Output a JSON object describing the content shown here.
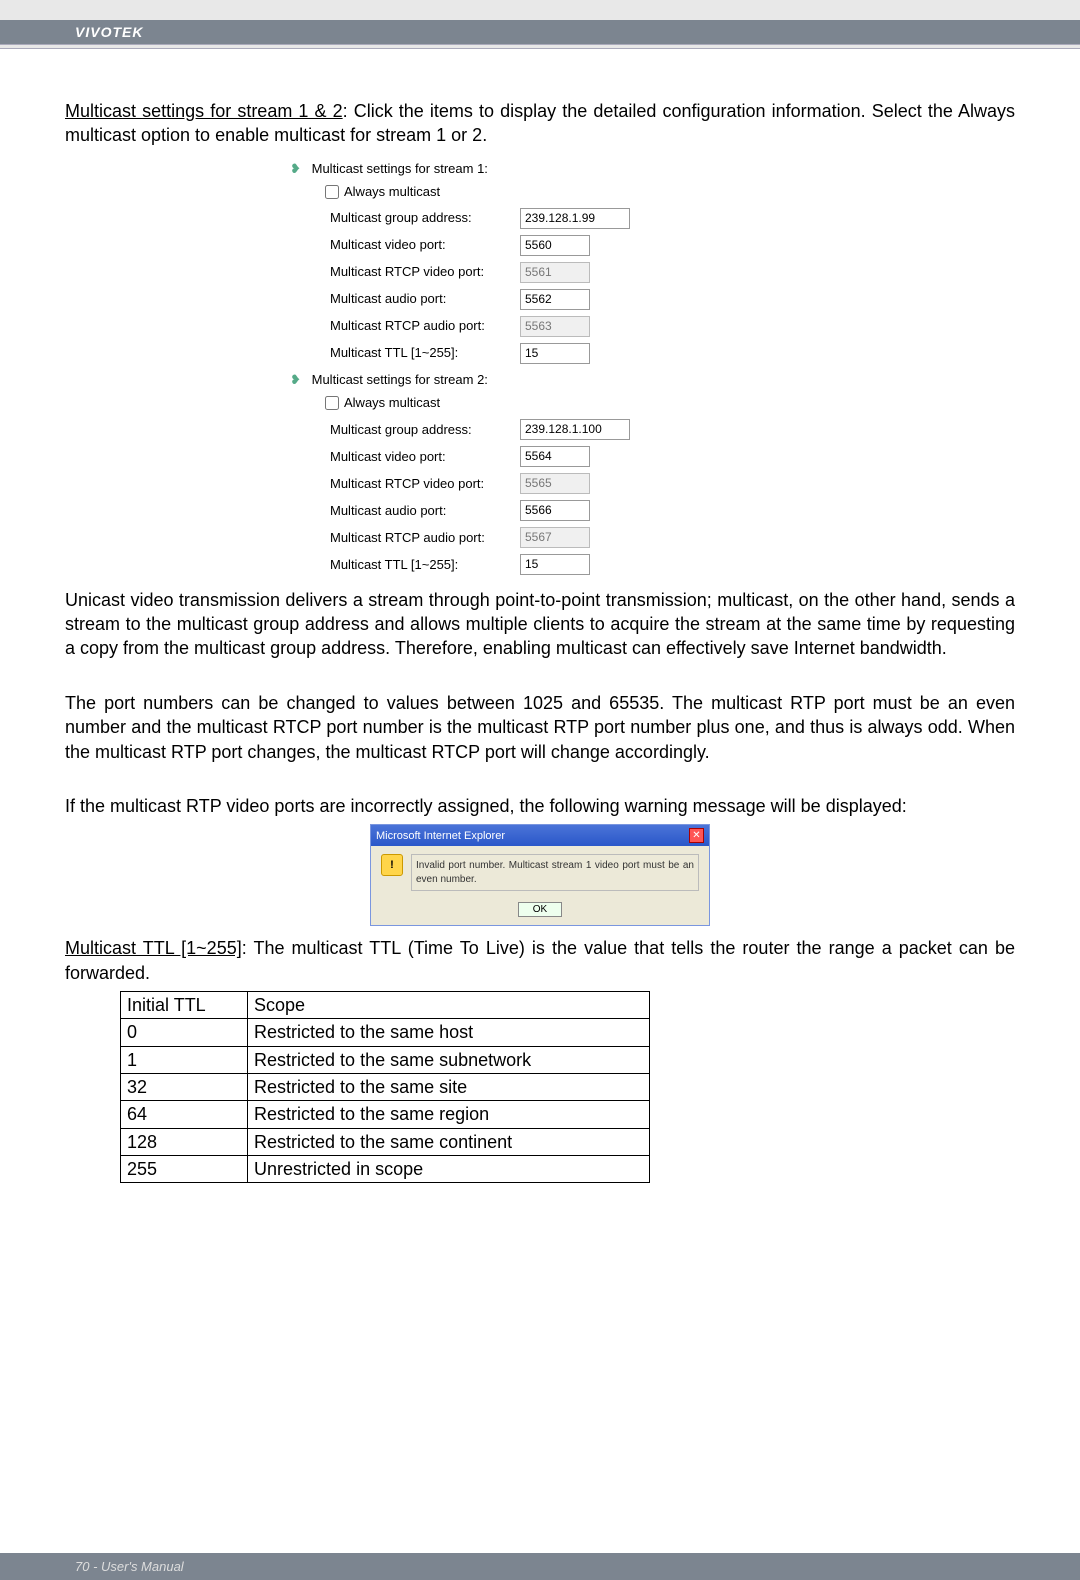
{
  "header": {
    "brand": "VIVOTEK"
  },
  "intro": {
    "heading": "Multicast settings for stream 1 & 2",
    "rest": ": Click the items to display the detailed configuration information. Select the Always multicast option to enable multicast for stream 1 or 2."
  },
  "stream1": {
    "title": "Multicast settings for stream 1:",
    "always": "Always multicast",
    "rows": {
      "group_addr_label": "Multicast group address:",
      "group_addr": "239.128.1.99",
      "video_port_label": "Multicast video port:",
      "video_port": "5560",
      "rtcp_video_label": "Multicast RTCP video port:",
      "rtcp_video": "5561",
      "audio_port_label": "Multicast audio port:",
      "audio_port": "5562",
      "rtcp_audio_label": "Multicast RTCP audio port:",
      "rtcp_audio": "5563",
      "ttl_label": "Multicast TTL [1~255]:",
      "ttl": "15"
    }
  },
  "stream2": {
    "title": "Multicast settings for stream 2:",
    "always": "Always multicast",
    "rows": {
      "group_addr_label": "Multicast group address:",
      "group_addr": "239.128.1.100",
      "video_port_label": "Multicast video port:",
      "video_port": "5564",
      "rtcp_video_label": "Multicast RTCP video port:",
      "rtcp_video": "5565",
      "audio_port_label": "Multicast audio port:",
      "audio_port": "5566",
      "rtcp_audio_label": "Multicast RTCP audio port:",
      "rtcp_audio": "5567",
      "ttl_label": "Multicast TTL [1~255]:",
      "ttl": "15"
    }
  },
  "body": {
    "p1": "Unicast video transmission delivers a stream through point-to-point transmission; multicast, on the other hand, sends a stream to the multicast group address and allows multiple clients to acquire the stream at the same time by requesting a copy from the multicast group address. Therefore, enabling multicast can effectively save Internet bandwidth.",
    "p2": "The port numbers can be changed to values between 1025 and 65535. The multicast RTP port must be an even number and the multicast RTCP port number is the multicast RTP port number plus one, and thus is always odd. When the multicast RTP port changes, the multicast RTCP port will change accordingly.",
    "p3": "If the multicast RTP video ports are incorrectly assigned, the following warning message will be displayed:"
  },
  "dialog": {
    "title": "Microsoft Internet Explorer",
    "message": "Invalid port number. Multicast stream 1 video port must be an even number.",
    "ok": "OK"
  },
  "ttl_section": {
    "heading": "Multicast TTL [1~255]",
    "rest": ": The multicast TTL (Time To Live) is the value that tells the router the range a packet can be forwarded."
  },
  "ttl_table": {
    "headers": {
      "col1": "Initial TTL",
      "col2": "Scope"
    },
    "rows": [
      {
        "ttl": "0",
        "scope": "Restricted to the same host"
      },
      {
        "ttl": "1",
        "scope": "Restricted to the same subnetwork"
      },
      {
        "ttl": "32",
        "scope": "Restricted to the same site"
      },
      {
        "ttl": "64",
        "scope": "Restricted to the same region"
      },
      {
        "ttl": "128",
        "scope": "Restricted to the same continent"
      },
      {
        "ttl": "255",
        "scope": "Unrestricted in scope"
      }
    ]
  },
  "footer": {
    "text": "70 - User's Manual"
  }
}
